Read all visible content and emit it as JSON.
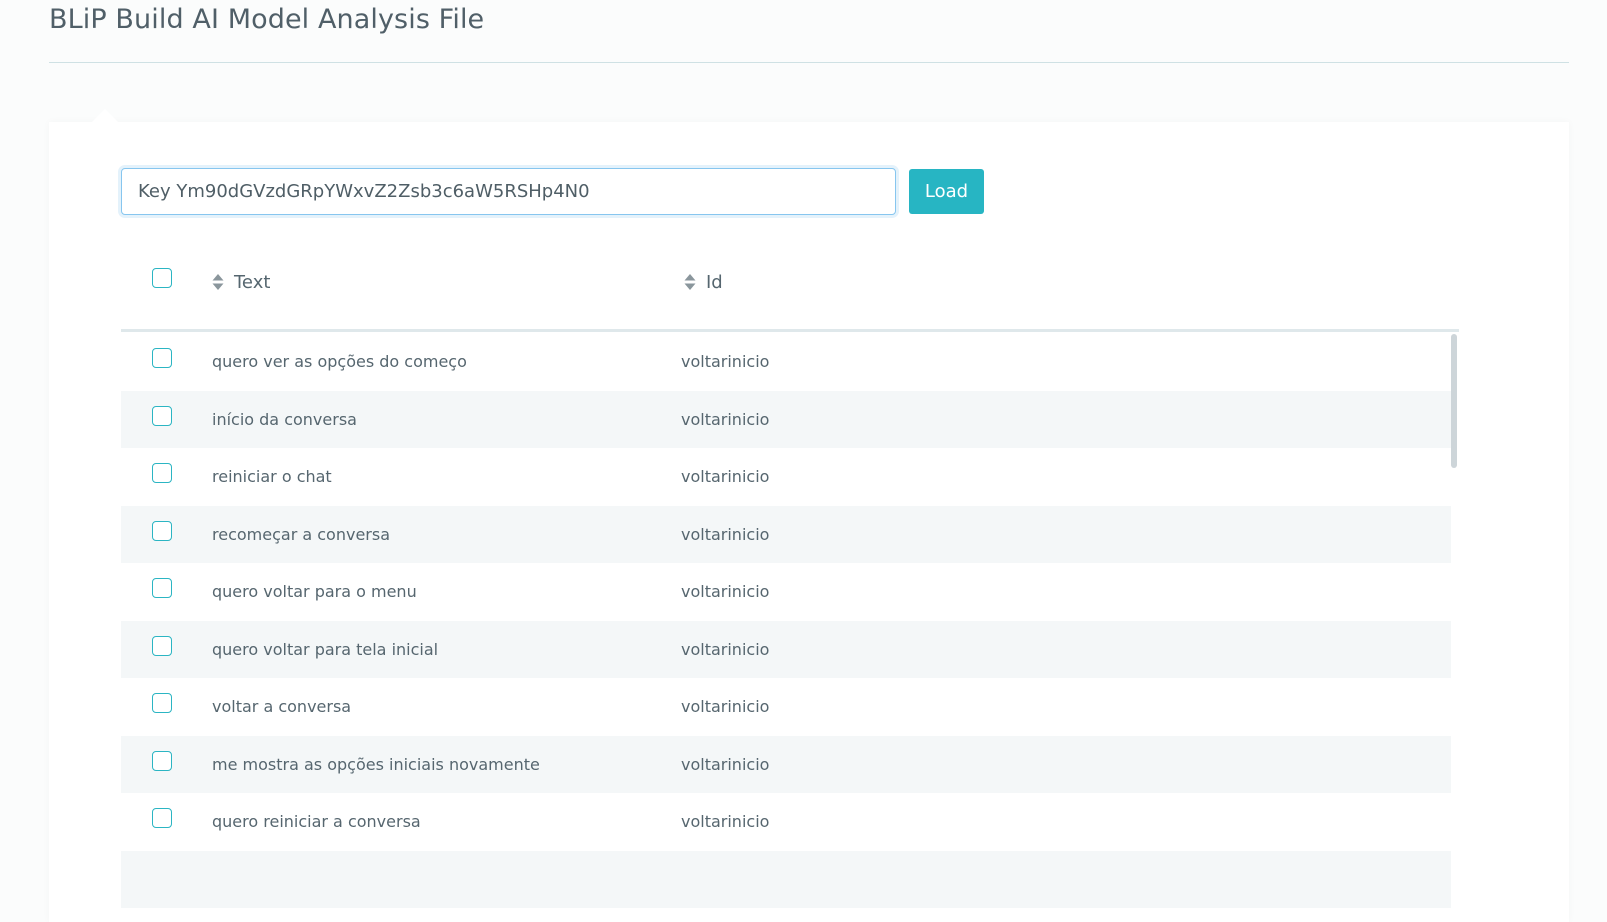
{
  "header": {
    "title": "BLiP Build AI Model Analysis File"
  },
  "key_form": {
    "input_value": "Key Ym90dGVzdGRpYWxvZ2Zsb3c6aW5RSHp4N0",
    "load_label": "Load"
  },
  "table": {
    "columns": [
      "Text",
      "Id"
    ],
    "rows": [
      {
        "text": "quero ver as opções do começo",
        "id": "voltarinicio"
      },
      {
        "text": "início da conversa",
        "id": "voltarinicio"
      },
      {
        "text": "reiniciar o chat",
        "id": "voltarinicio"
      },
      {
        "text": "recomeçar a conversa",
        "id": "voltarinicio"
      },
      {
        "text": "quero voltar para o menu",
        "id": "voltarinicio"
      },
      {
        "text": "quero voltar para tela inicial",
        "id": "voltarinicio"
      },
      {
        "text": "voltar a conversa",
        "id": "voltarinicio"
      },
      {
        "text": "me mostra as opções iniciais novamente",
        "id": "voltarinicio"
      },
      {
        "text": "quero reiniciar a conversa",
        "id": "voltarinicio"
      }
    ]
  },
  "colors": {
    "accent": "#27b5c3",
    "checkbox_border": "#2bb5c3",
    "alt_row": "#f4f7f8"
  },
  "icons": {
    "sort": "sort-icon"
  }
}
